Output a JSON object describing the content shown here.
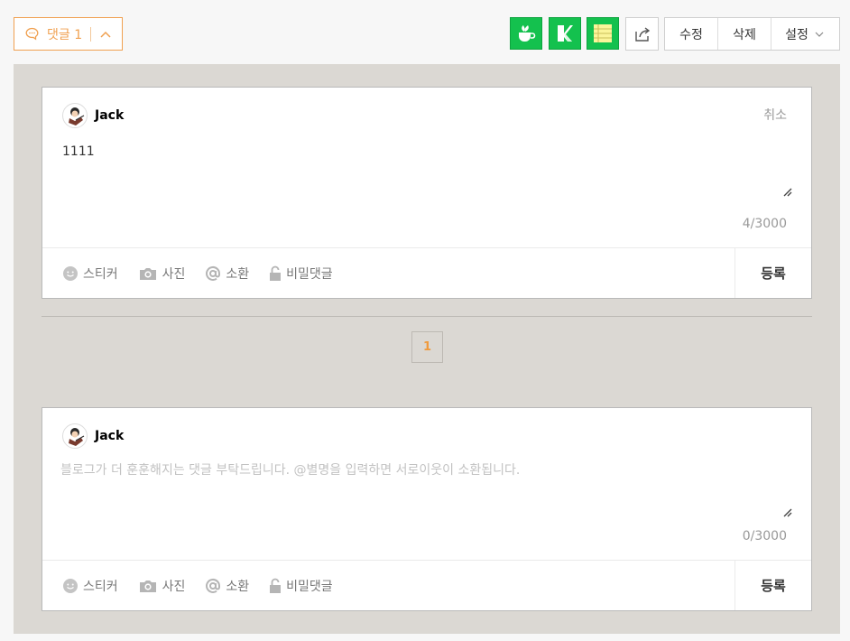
{
  "top": {
    "comment_label": "댓글 1",
    "actions": [
      "수정",
      "삭제",
      "설정"
    ],
    "colors": {
      "accent": "#f0a050",
      "app_green": "#14c14e"
    },
    "app_icons": [
      "cafe-icon",
      "note-k-icon",
      "memo-icon"
    ]
  },
  "editor": {
    "nickname": "Jack",
    "cancel_label": "취소",
    "text": "1111",
    "counter": "4/3000",
    "tools": [
      "스티커",
      "사진",
      "소환",
      "비밀댓글"
    ],
    "submit_label": "등록"
  },
  "pagination": {
    "current": "1"
  },
  "new_comment": {
    "nickname": "Jack",
    "placeholder": "블로그가 더 훈훈해지는 댓글 부탁드립니다. @별명을 입력하면 서로이웃이 소환됩니다.",
    "counter": "0/3000",
    "tools": [
      "스티커",
      "사진",
      "소환",
      "비밀댓글"
    ],
    "submit_label": "등록"
  }
}
